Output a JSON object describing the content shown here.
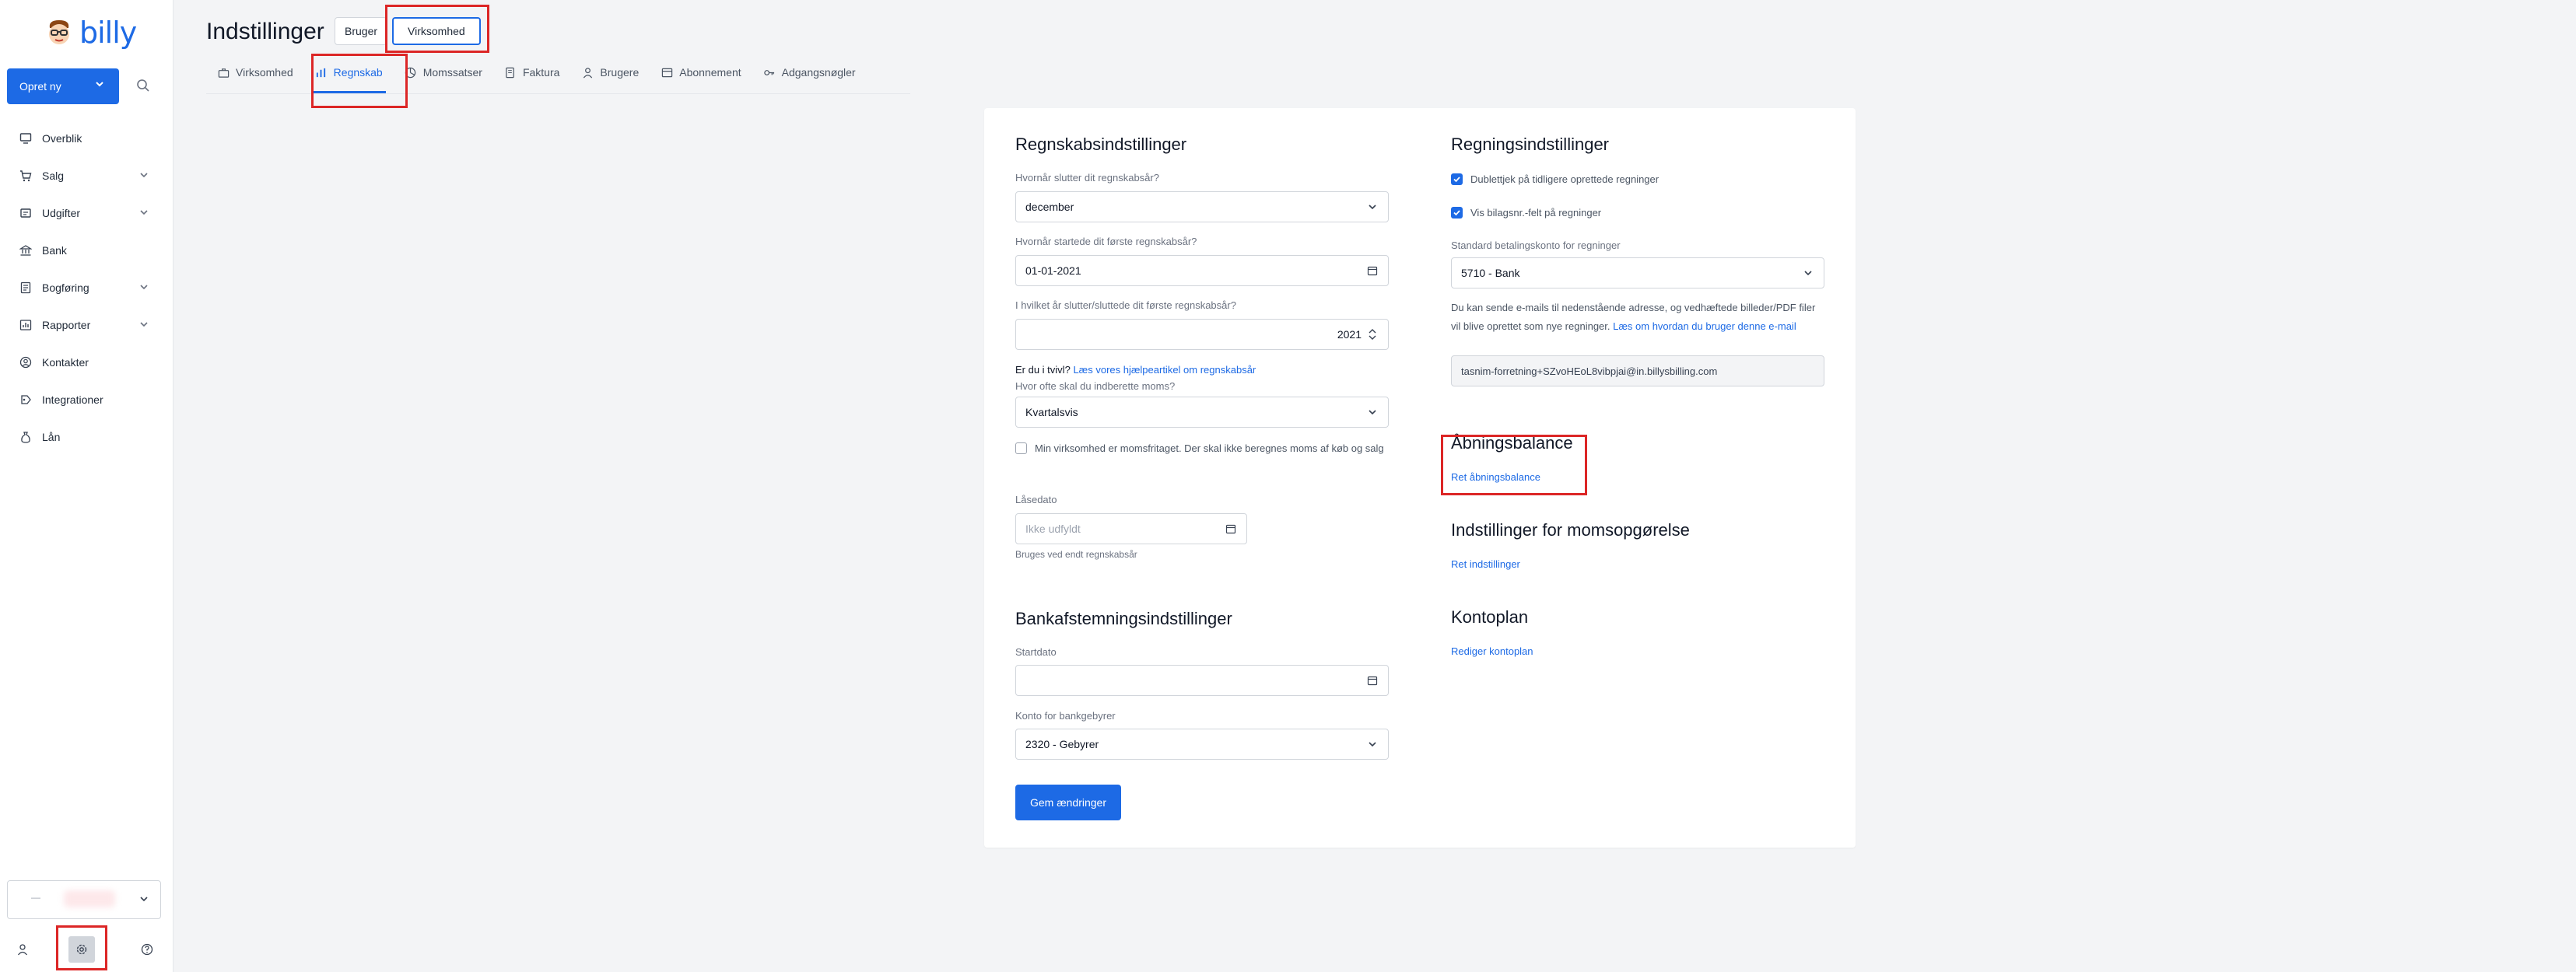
{
  "sidebar": {
    "brand": "billy",
    "create_button": "Opret ny",
    "items": [
      {
        "label": "Overblik",
        "icon": "monitor-icon",
        "chevron": false
      },
      {
        "label": "Salg",
        "icon": "cart-icon",
        "chevron": true
      },
      {
        "label": "Udgifter",
        "icon": "receipt-icon",
        "chevron": true
      },
      {
        "label": "Bank",
        "icon": "bank-icon",
        "chevron": false
      },
      {
        "label": "Bogføring",
        "icon": "ledger-icon",
        "chevron": true
      },
      {
        "label": "Rapporter",
        "icon": "report-icon",
        "chevron": true
      },
      {
        "label": "Kontakter",
        "icon": "contacts-icon",
        "chevron": false
      },
      {
        "label": "Integrationer",
        "icon": "integrations-icon",
        "chevron": false
      },
      {
        "label": "Lån",
        "icon": "loan-icon",
        "chevron": false
      }
    ],
    "company_dash": "—"
  },
  "header": {
    "title": "Indstillinger",
    "scope_tabs": [
      "Bruger",
      "Virksomhed"
    ],
    "sub_tabs": [
      "Virksomhed",
      "Regnskab",
      "Momssatser",
      "Faktura",
      "Brugere",
      "Abonnement",
      "Adgangsnøgler"
    ],
    "active_sub_tab": "Regnskab"
  },
  "accounting": {
    "title": "Regnskabsindstillinger",
    "fiscal_end_label": "Hvornår slutter dit regnskabsår?",
    "fiscal_end_value": "december",
    "first_start_label": "Hvornår startede dit første regnskabsår?",
    "first_start_value": "01-01-2021",
    "first_end_label": "I hvilket år slutter/sluttede dit første regnskabsår?",
    "first_end_value": "2021",
    "doubt_prefix": "Er du i tvivl?",
    "doubt_link": "Læs vores hjælpeartikel om regnskabsår",
    "vat_freq_label": "Hvor ofte skal du indberette moms?",
    "vat_freq_value": "Kvartalsvis",
    "vat_exempt_label": "Min virksomhed er momsfritaget. Der skal ikke beregnes moms af køb og salg",
    "lock_label": "Låsedato",
    "lock_placeholder": "Ikke udfyldt",
    "lock_help": "Bruges ved endt regnskabsår"
  },
  "bank_recon": {
    "title": "Bankafstemningsindstillinger",
    "start_label": "Startdato",
    "fee_label": "Konto for bankgebyrer",
    "fee_value": "2320 - Gebyrer",
    "save_button": "Gem ændringer"
  },
  "bills": {
    "title": "Regningsindstillinger",
    "dup_check": "Dublettjek på tidligere oprettede regninger",
    "show_voucher": "Vis bilagsnr.-felt på regninger",
    "payment_account_label": "Standard betalingskonto for regninger",
    "payment_account_value": "5710 - Bank",
    "email_text": "Du kan sende e-mails til nedenstående adresse, og vedhæftede billeder/PDF filer vil blive oprettet som nye regninger.",
    "email_link": "Læs om hvordan du bruger denne e-mail",
    "email_address": "tasnim-forretning+SZvoHEoL8vibpjai@in.billysbilling.com"
  },
  "opening_balance": {
    "title": "Åbningsbalance",
    "link": "Ret åbningsbalance"
  },
  "vat_settlement": {
    "title": "Indstillinger for momsopgørelse",
    "link": "Ret indstillinger"
  },
  "chart_of_accounts": {
    "title": "Kontoplan",
    "link": "Rediger kontoplan"
  },
  "colors": {
    "accent": "#1d6ae5",
    "highlight": "#dc2626"
  }
}
